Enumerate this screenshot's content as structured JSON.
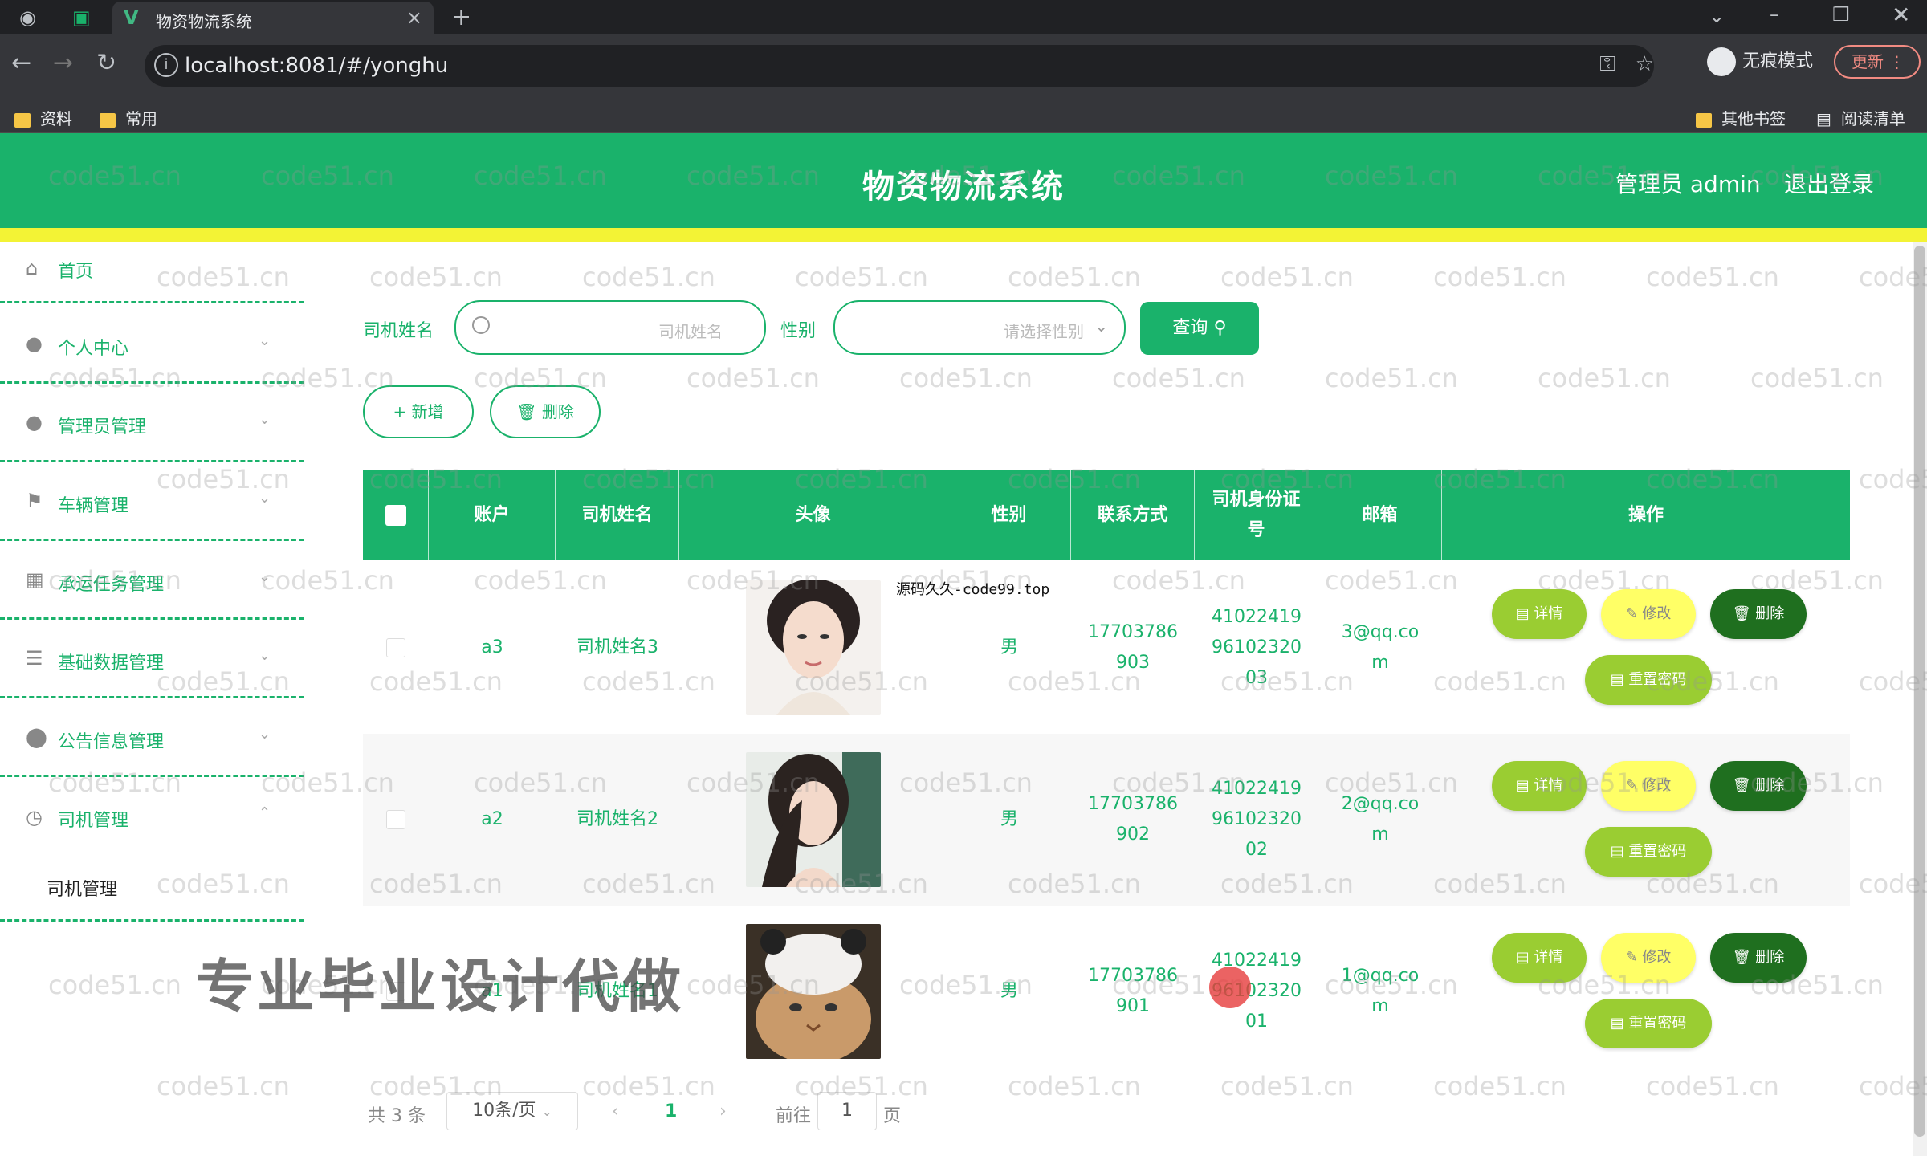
{
  "browser": {
    "tab_title": "物资物流系统",
    "url": "localhost:8081/#/yonghu",
    "incognito_label": "无痕模式",
    "update_label": "更新",
    "bookmarks": [
      "资料",
      "常用"
    ],
    "bookmarks_right": [
      "其他书签",
      "阅读清单"
    ]
  },
  "header": {
    "title": "物资物流系统",
    "admin_label": "管理员 admin",
    "logout_label": "退出登录"
  },
  "sidebar": {
    "items": [
      {
        "label": "首页",
        "icon": "home-icon"
      },
      {
        "label": "个人中心",
        "icon": "user-icon"
      },
      {
        "label": "管理员管理",
        "icon": "user-icon"
      },
      {
        "label": "车辆管理",
        "icon": "flag-icon"
      },
      {
        "label": "承运任务管理",
        "icon": "folder-icon"
      },
      {
        "label": "基础数据管理",
        "icon": "stack-icon"
      },
      {
        "label": "公告信息管理",
        "icon": "location-icon"
      },
      {
        "label": "司机管理",
        "icon": "clock-icon"
      }
    ],
    "submenu_label": "司机管理"
  },
  "search": {
    "name_label": "司机姓名",
    "name_placeholder": "司机姓名",
    "gender_label": "性别",
    "gender_placeholder": "请选择性别",
    "query_label": "查询"
  },
  "actions": {
    "add_label": "+ 新增",
    "delete_label": "删除"
  },
  "table": {
    "headers": [
      "账户",
      "司机姓名",
      "头像",
      "性别",
      "联系方式",
      "司机身份证号",
      "邮箱",
      "操作"
    ],
    "rows": [
      {
        "account": "a3",
        "name": "司机姓名3",
        "gender": "男",
        "phone": "17703786903",
        "idcard": "410224199610232003",
        "email": "3@qq.com"
      },
      {
        "account": "a2",
        "name": "司机姓名2",
        "gender": "男",
        "phone": "17703786902",
        "idcard": "410224199610232002",
        "email": "2@qq.com"
      },
      {
        "account": "a1",
        "name": "司机姓名1",
        "gender": "男",
        "phone": "17703786901",
        "idcard": "410224199610232001",
        "email": "1@qq.com"
      }
    ],
    "btn_detail": "详情",
    "btn_edit": "修改",
    "btn_delete": "删除",
    "btn_reset": "重置密码"
  },
  "pagination": {
    "total": "共 3 条",
    "page_size": "10条/页",
    "current": "1",
    "goto_label": "前往",
    "goto_value": "1",
    "page_suffix": "页"
  },
  "overlays": {
    "watermark": "code51.cn",
    "ad_text": "专业毕业设计代做",
    "source_text": "源码久久-code99.top"
  },
  "colors": {
    "primary": "#1ab26b",
    "accent_yellow": "#f3f335"
  }
}
